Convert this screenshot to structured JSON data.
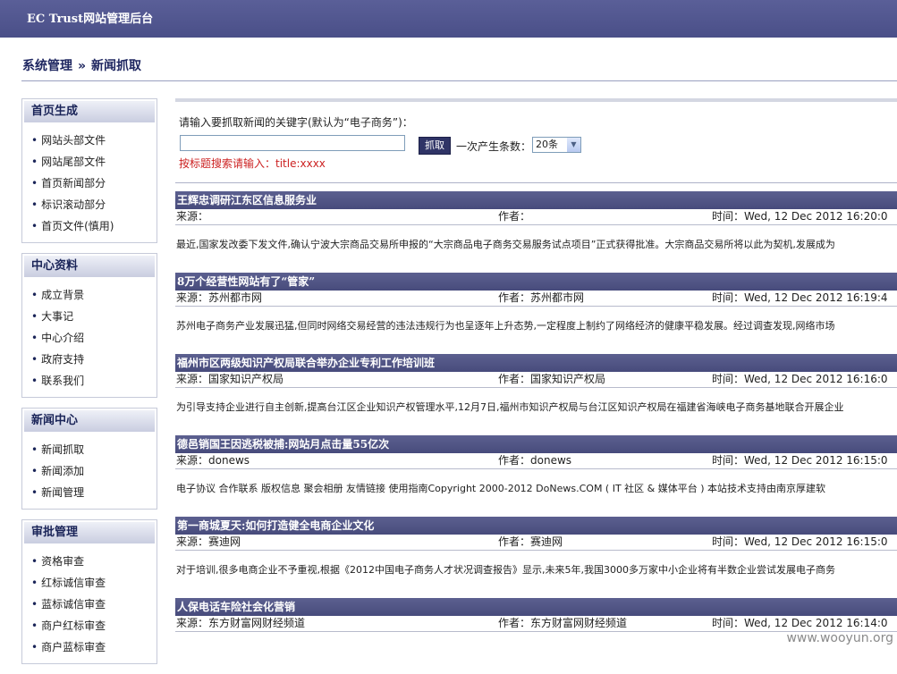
{
  "app": {
    "title": "EC Trust网站管理后台"
  },
  "breadcrumb": {
    "root": "系统管理",
    "sep": "»",
    "current": "新闻抓取"
  },
  "sidebar": {
    "groups": [
      {
        "title": "首页生成",
        "items": [
          "网站头部文件",
          "网站尾部文件",
          "首页新闻部分",
          "标识滚动部分",
          "首页文件(慎用)"
        ]
      },
      {
        "title": "中心资料",
        "items": [
          "成立背景",
          "大事记",
          "中心介绍",
          "政府支持",
          "联系我们"
        ]
      },
      {
        "title": "新闻中心",
        "items": [
          "新闻抓取",
          "新闻添加",
          "新闻管理"
        ]
      },
      {
        "title": "审批管理",
        "items": [
          "资格审查",
          "红标诚信审查",
          "蓝标诚信审查",
          "商户红标审查",
          "商户蓝标审查"
        ]
      }
    ]
  },
  "search": {
    "prompt": "请输入要抓取新闻的关键字(默认为“电子商务”)：",
    "keyword_value": "",
    "button": "抓取",
    "count_label": "一次产生条数：",
    "count_value": "20条",
    "hint": "按标题搜索请输入：title:xxxx"
  },
  "labels": {
    "source": "来源：",
    "author": "作者：",
    "time": "时间："
  },
  "news": [
    {
      "title": "王辉忠调研江东区信息服务业",
      "source": "",
      "author": "",
      "time": "Wed, 12 Dec 2012 16:20:0",
      "body": "最近,国家发改委下发文件,确认宁波大宗商品交易所申报的“大宗商品电子商务交易服务试点项目”正式获得批准。大宗商品交易所将以此为契机,发展成为"
    },
    {
      "title": "8万个经营性网站有了“管家”",
      "source": "苏州都市网",
      "author": "苏州都市网",
      "time": "Wed, 12 Dec 2012 16:19:4",
      "body": "苏州电子商务产业发展迅猛,但同时网络交易经营的违法违规行为也呈逐年上升态势,一定程度上制约了网络经济的健康平稳发展。经过调查发现,网络市场"
    },
    {
      "title": "福州市区两级知识产权局联合举办企业专利工作培训班",
      "source": "国家知识产权局",
      "author": "国家知识产权局",
      "time": "Wed, 12 Dec 2012 16:16:0",
      "body": "为引导支持企业进行自主创新,提高台江区企业知识产权管理水平,12月7日,福州市知识产权局与台江区知识产权局在福建省海峡电子商务基地联合开展企业"
    },
    {
      "title": "德邑销国王因逃税被捕:网站月点击量55亿次",
      "source": "donews",
      "author": "donews",
      "time": "Wed, 12 Dec 2012 16:15:0",
      "body": "电子协议 合作联系 版权信息 聚会相册 友情链接 使用指南Copyright 2000-2012 DoNews.COM ( IT 社区 & 媒体平台 ) 本站技术支持由南京厚建软"
    },
    {
      "title": "第一商城夏天:如何打造健全电商企业文化",
      "source": "赛迪网",
      "author": "赛迪网",
      "time": "Wed, 12 Dec 2012 16:15:0",
      "body": "对于培训,很多电商企业不予重视,根据《2012中国电子商务人才状况调查报告》显示,未来5年,我国3000多万家中小企业将有半数企业尝试发展电子商务"
    },
    {
      "title": "人保电话车险社会化营销",
      "source": "东方财富网财经频道",
      "author": "东方财富网财经频道",
      "time": "Wed, 12 Dec 2012 16:14:0",
      "body": ""
    }
  ],
  "watermark": "www.wooyun.org"
}
